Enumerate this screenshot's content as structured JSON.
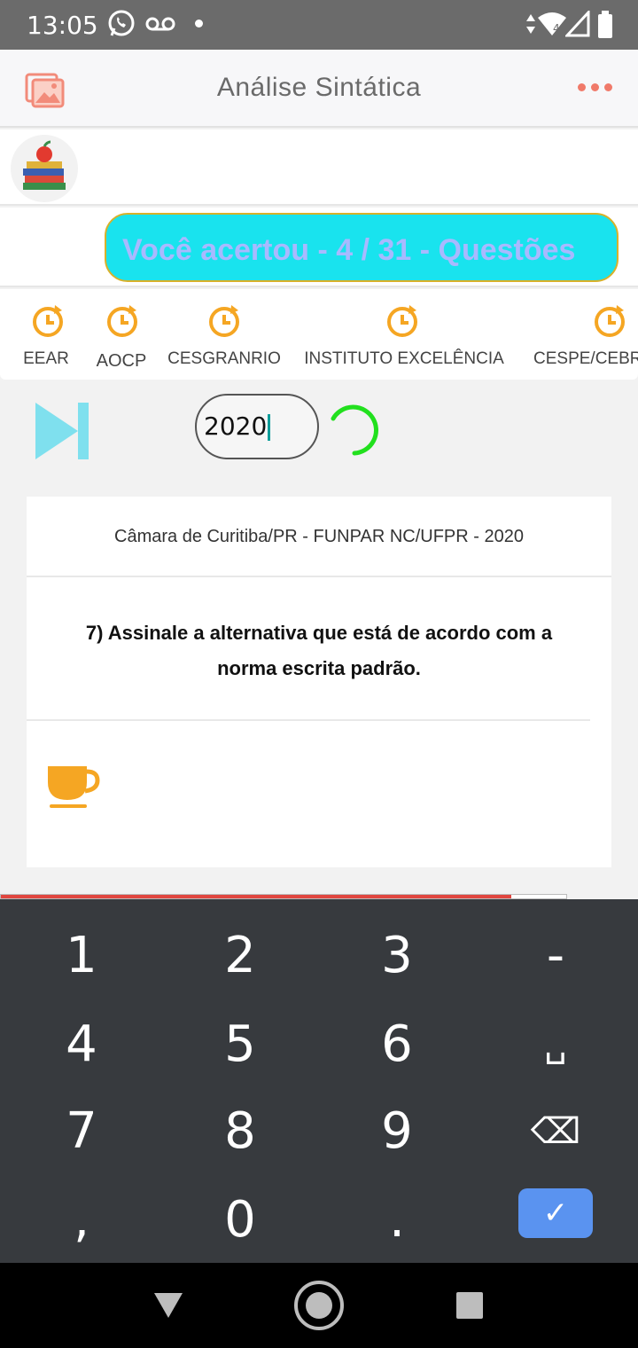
{
  "status_bar": {
    "time": "13:05"
  },
  "app_bar": {
    "title": "Análise Sintática"
  },
  "score": {
    "text": "Você acertou  -  4 / 31  -  Questões"
  },
  "tabs": [
    {
      "label": "EEAR"
    },
    {
      "label": "AOCP"
    },
    {
      "label": "CESGRANRIO"
    },
    {
      "label": "INSTITUTO EXCELÊNCIA"
    },
    {
      "label": "CESPE/CEBRASPE"
    }
  ],
  "year_input": {
    "value": "2020"
  },
  "question_card": {
    "source": "Câmara de Curitiba/PR - FUNPAR NC/UFPR - 2020",
    "question": "7) Assinale a alternativa que está de acordo com a norma escrita padrão."
  },
  "keyboard": {
    "keys": [
      "1",
      "2",
      "3",
      "-",
      "4",
      "5",
      "6",
      "␣",
      "7",
      "8",
      "9",
      "⌫",
      ",",
      "0",
      ".",
      "✓"
    ]
  },
  "colors": {
    "accent_orange": "#f5a623",
    "score_bg": "#19e3ee",
    "score_text": "#a8b9ff",
    "keyboard_bg": "#373a3e",
    "enter_blue": "#5a93f0",
    "skip_cyan": "#7fe0ee"
  },
  "icons": {
    "app_bar": [
      "gallery-icon",
      "more-options-icon"
    ],
    "controls": [
      "skip-next-icon",
      "loading-spinner"
    ],
    "card": [
      "coffee-cup-icon"
    ]
  }
}
